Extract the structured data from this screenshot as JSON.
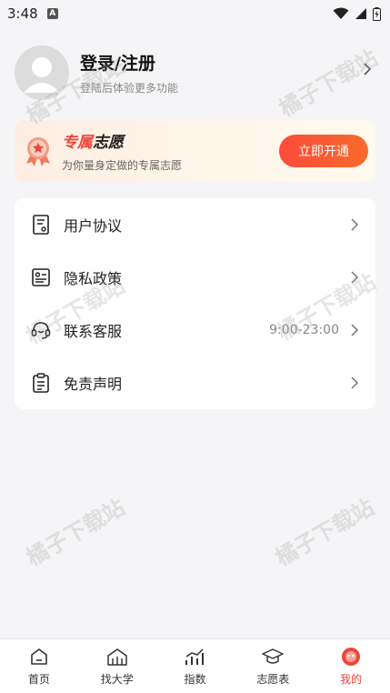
{
  "status_bar": {
    "time": "3:48",
    "sim_label": "A"
  },
  "profile": {
    "title": "登录/注册",
    "subtitle": "登陆后体验更多功能"
  },
  "vip": {
    "title_accent": "专属",
    "title_rest": "志愿",
    "subtitle": "为你量身定做的专属志愿",
    "button_label": "立即开通"
  },
  "menu": {
    "items": [
      {
        "label": "用户协议",
        "icon": "document-icon",
        "extra": ""
      },
      {
        "label": "隐私政策",
        "icon": "id-card-icon",
        "extra": ""
      },
      {
        "label": "联系客服",
        "icon": "headset-icon",
        "extra": "9:00-23:00"
      },
      {
        "label": "免责声明",
        "icon": "clipboard-icon",
        "extra": ""
      }
    ]
  },
  "watermark": "橘子下载站",
  "tabs": [
    {
      "label": "首页",
      "icon": "home-icon",
      "active": false
    },
    {
      "label": "找大学",
      "icon": "university-icon",
      "active": false
    },
    {
      "label": "指数",
      "icon": "chart-icon",
      "active": false
    },
    {
      "label": "志愿表",
      "icon": "graduation-cap-icon",
      "active": false
    },
    {
      "label": "我的",
      "icon": "profile-icon",
      "active": true
    }
  ],
  "colors": {
    "accent": "#f0453a",
    "background": "#f5f5f7"
  }
}
